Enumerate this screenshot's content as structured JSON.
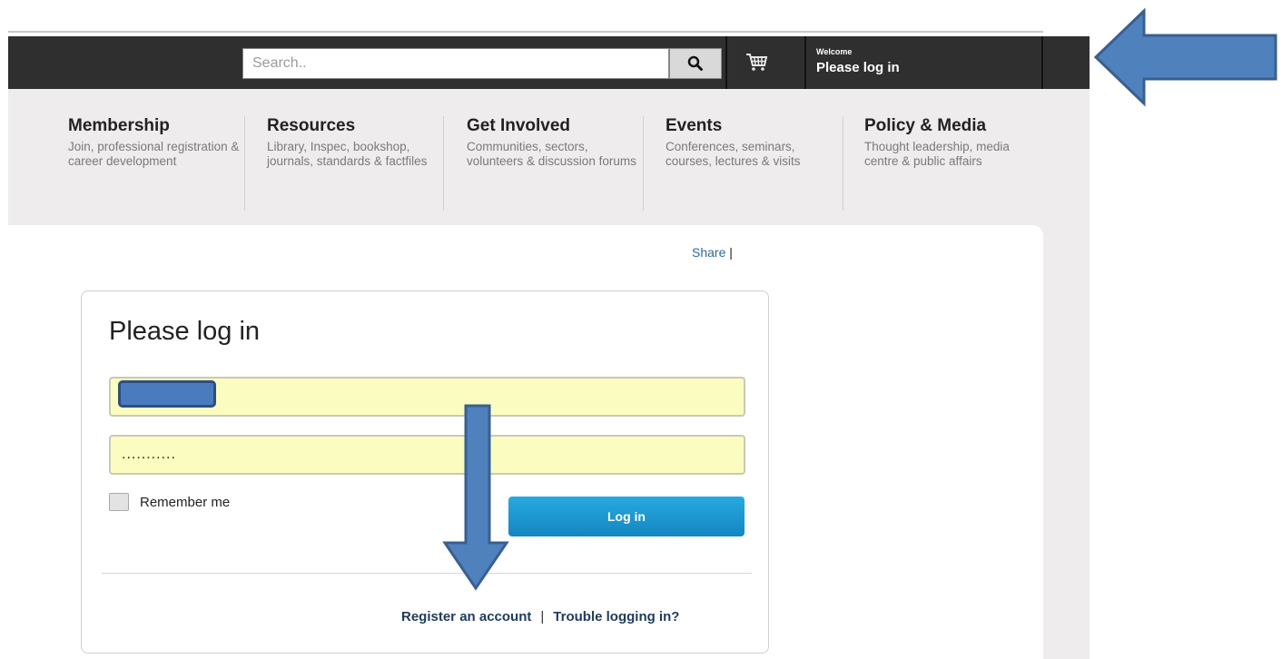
{
  "header": {
    "search_placeholder": "Search..",
    "welcome_label": "Welcome",
    "welcome_status": "Please log in"
  },
  "nav": [
    {
      "title": "Membership",
      "desc": "Join, professional registration & career development"
    },
    {
      "title": "Resources",
      "desc": "Library, Inspec, bookshop, journals, standards & factfiles"
    },
    {
      "title": "Get Involved",
      "desc": "Communities, sectors, volunteers & discussion forums"
    },
    {
      "title": "Events",
      "desc": "Conferences, seminars, courses, lectures & visits"
    },
    {
      "title": "Policy & Media",
      "desc": "Thought leadership, media centre & public affairs"
    }
  ],
  "share": {
    "label": "Share",
    "separator": "|"
  },
  "login": {
    "heading": "Please log in",
    "username_value": "",
    "password_value": "...........",
    "remember_label": "Remember me",
    "button_label": "Log in",
    "register_link": "Register an account",
    "link_separator": "|",
    "trouble_link": "Trouble logging in?"
  },
  "annotations": {
    "arrow_color": "#4f81bd",
    "arrow_border": "#3a5f8f"
  }
}
